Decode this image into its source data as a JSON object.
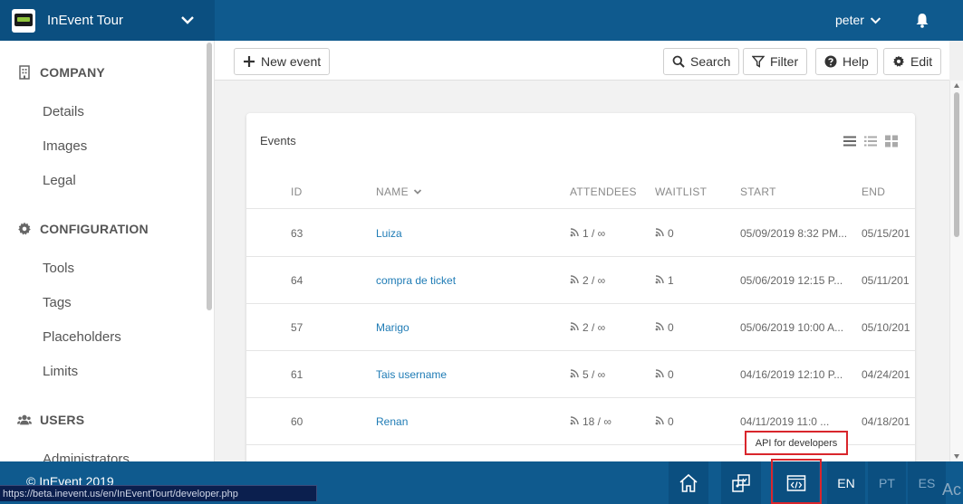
{
  "app": {
    "title": "InEvent Tour",
    "user": "peter"
  },
  "sidebar": {
    "sections": [
      {
        "label": "COMPANY",
        "icon": "building-icon",
        "items": [
          "Details",
          "Images",
          "Legal"
        ]
      },
      {
        "label": "CONFIGURATION",
        "icon": "gear-icon",
        "items": [
          "Tools",
          "Tags",
          "Placeholders",
          "Limits"
        ]
      },
      {
        "label": "USERS",
        "icon": "users-icon",
        "items": [
          "Administrators"
        ]
      }
    ]
  },
  "toolbar": {
    "new_event": "New event",
    "search": "Search",
    "filter": "Filter",
    "help": "Help",
    "edit": "Edit"
  },
  "events": {
    "title": "Events",
    "columns": [
      "ID",
      "NAME",
      "ATTENDEES",
      "WAITLIST",
      "START",
      "END"
    ],
    "rows": [
      {
        "id": "63",
        "name": "Luiza",
        "attendees": "1 / ∞",
        "waitlist": "0",
        "start": "05/09/2019 8:32 PM...",
        "end": "05/15/201"
      },
      {
        "id": "64",
        "name": "compra de ticket",
        "attendees": "2 / ∞",
        "waitlist": "1",
        "start": "05/06/2019 12:15 P...",
        "end": "05/11/201"
      },
      {
        "id": "57",
        "name": "Marigo",
        "attendees": "2 / ∞",
        "waitlist": "0",
        "start": "05/06/2019 10:00 A...",
        "end": "05/10/201"
      },
      {
        "id": "61",
        "name": "Tais username",
        "attendees": "5 / ∞",
        "waitlist": "0",
        "start": "04/16/2019 12:10 P...",
        "end": "04/24/201"
      },
      {
        "id": "60",
        "name": "Renan",
        "attendees": "18 / ∞",
        "waitlist": "0",
        "start": "04/11/2019 11:0 ...",
        "end": "04/18/201"
      }
    ]
  },
  "tooltip": "API for developers",
  "footer": {
    "copyright": "© InEvent 2019",
    "languages": [
      "EN",
      "PT",
      "ES"
    ],
    "activate": "Ac"
  },
  "status_url": "https://beta.inevent.us/en/InEventTourt/developer.php",
  "colors": {
    "primary": "#0f5a8e",
    "primary_dark": "#0b4f80",
    "link": "#1e7bb5",
    "highlight": "#d9262c"
  }
}
